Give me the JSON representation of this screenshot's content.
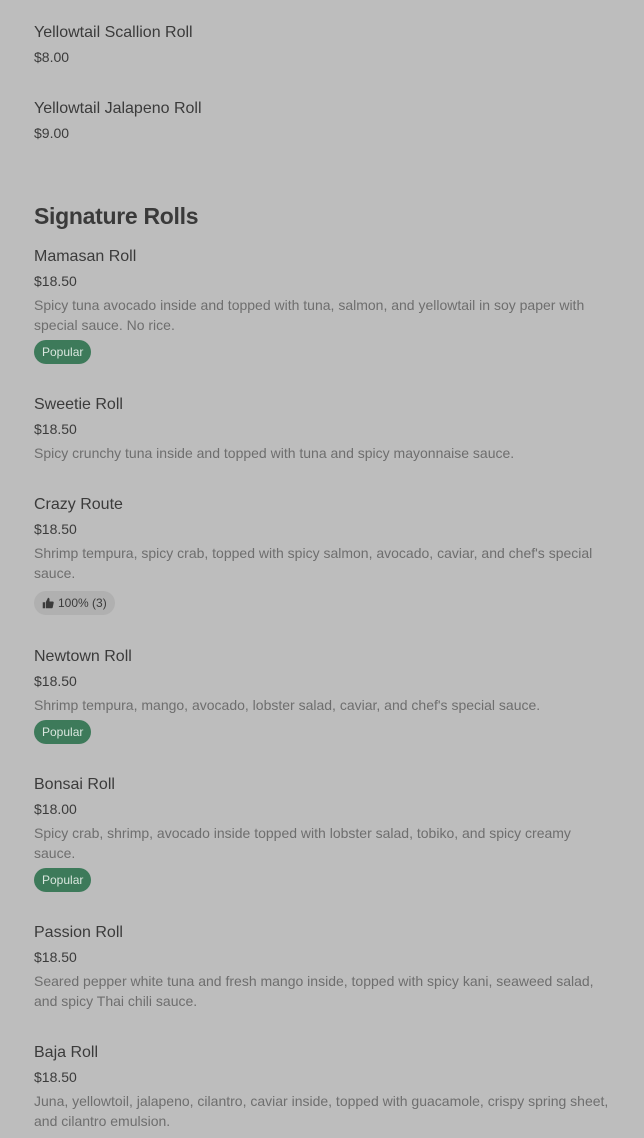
{
  "previous_items": [
    {
      "name": "Yellowtail Scallion Roll",
      "price": "$8.00"
    },
    {
      "name": "Yellowtail Jalapeno Roll",
      "price": "$9.00"
    }
  ],
  "section": {
    "title": "Signature Rolls",
    "items": [
      {
        "name": "Mamasan Roll",
        "price": "$18.50",
        "description": "Spicy tuna avocado inside and topped with tuna, salmon, and yellowtail in soy paper with special sauce. No rice.",
        "badge": "Popular"
      },
      {
        "name": "Sweetie Roll",
        "price": "$18.50",
        "description": "Spicy crunchy tuna inside and topped with tuna and spicy mayonnaise sauce."
      },
      {
        "name": "Crazy Route",
        "price": "$18.50",
        "description": "Shrimp tempura, spicy crab, topped with spicy salmon, avocado, caviar, and chef's special sauce.",
        "rating": "100% (3)"
      },
      {
        "name": "Newtown Roll",
        "price": "$18.50",
        "description": "Shrimp tempura, mango, avocado, lobster salad, caviar, and chef's special sauce.",
        "badge": "Popular"
      },
      {
        "name": "Bonsai Roll",
        "price": "$18.00",
        "description": "Spicy crab, shrimp, avocado inside topped with lobster salad, tobiko, and spicy creamy sauce.",
        "badge": "Popular"
      },
      {
        "name": "Passion Roll",
        "price": "$18.50",
        "description": "Seared pepper white tuna and fresh mango inside, topped with spicy kani, seaweed salad, and spicy Thai chili sauce."
      },
      {
        "name": "Baja Roll",
        "price": "$18.50",
        "description": "Juna, yellowtoil, jalapeno, cilantro, caviar inside, topped with guacamole, crispy spring sheet, and cilantro emulsion."
      }
    ]
  },
  "icons": {
    "rating": "thumbs-up-icon"
  },
  "colors": {
    "background": "#bdbdbd",
    "popular_badge": "#3d7a5a",
    "text": "#3b3b3b",
    "description": "#6e6e6e"
  }
}
